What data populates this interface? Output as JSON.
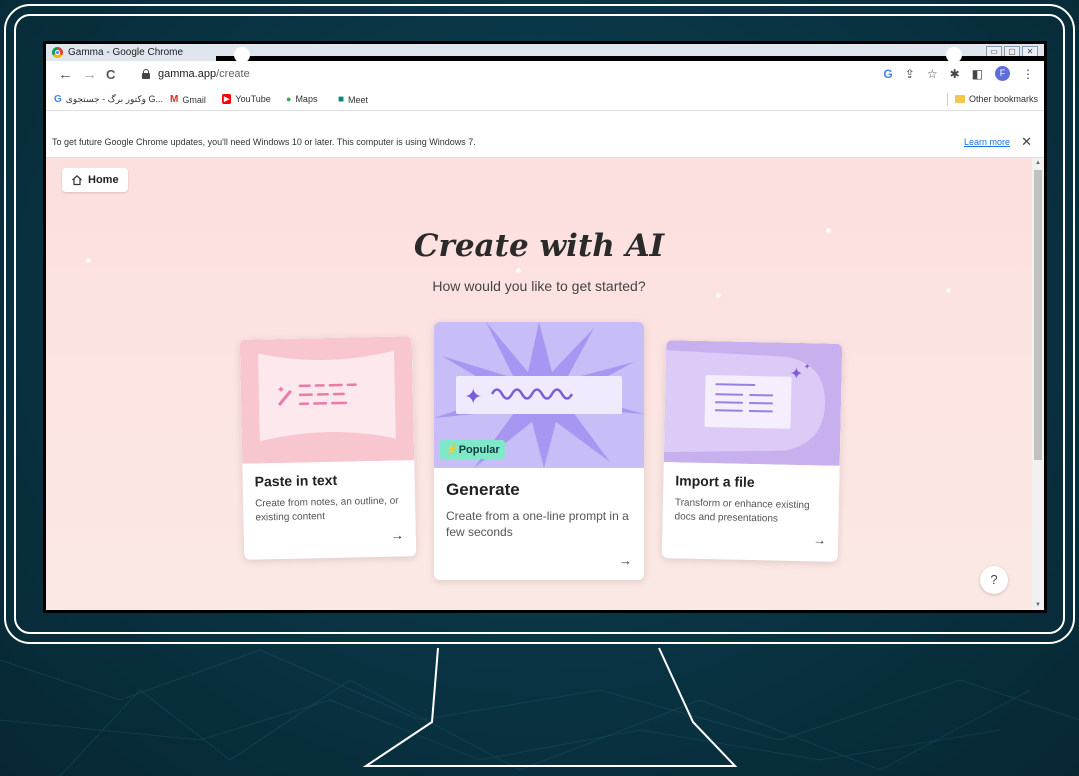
{
  "window": {
    "title": "Gamma - Google Chrome",
    "buttons": [
      "▭",
      "▢",
      "✕"
    ]
  },
  "toolbar": {
    "back": "←",
    "forward": "→",
    "reload": "C",
    "url_host": "gamma.app",
    "url_path": "/create",
    "profile_initial": "F"
  },
  "bookmarks": {
    "items": [
      {
        "icon": "G",
        "label": "وکتور برگ - جستجوی G...",
        "color": "#4285f4"
      },
      {
        "icon": "M",
        "label": "Gmail",
        "color": "#d93025"
      },
      {
        "icon": "▶",
        "label": "YouTube",
        "color": "#ff0000"
      },
      {
        "icon": "📍",
        "label": "Maps",
        "color": "#34a853"
      },
      {
        "icon": "■",
        "label": "Meet",
        "color": "#00897b"
      }
    ],
    "other": "Other bookmarks"
  },
  "infobar": {
    "message": "To get future Google Chrome updates, you'll need Windows 10 or later. This computer is using Windows 7.",
    "link": "Learn more",
    "close": "✕"
  },
  "page": {
    "home_label": "Home",
    "heading": "Create with AI",
    "subheading": "How would you like to get started?",
    "help": "?"
  },
  "cards": {
    "paste": {
      "title": "Paste in text",
      "desc": "Create from notes, an outline, or existing content",
      "arrow": "→"
    },
    "generate": {
      "title": "Generate",
      "desc": "Create from a one-line prompt in a few seconds",
      "arrow": "→",
      "badge": "⚡Popular"
    },
    "import": {
      "title": "Import a file",
      "desc": "Transform or enhance existing docs and presentations",
      "arrow": "→"
    }
  },
  "colors": {
    "background": "#0a3646",
    "page_bg": "#fcdfdf",
    "paste_art": "#f8c6cf",
    "generate_art": "#c7bdf7",
    "import_art": "#c8b0ee",
    "badge": "#7ee8c8",
    "link": "#1a73e8"
  }
}
